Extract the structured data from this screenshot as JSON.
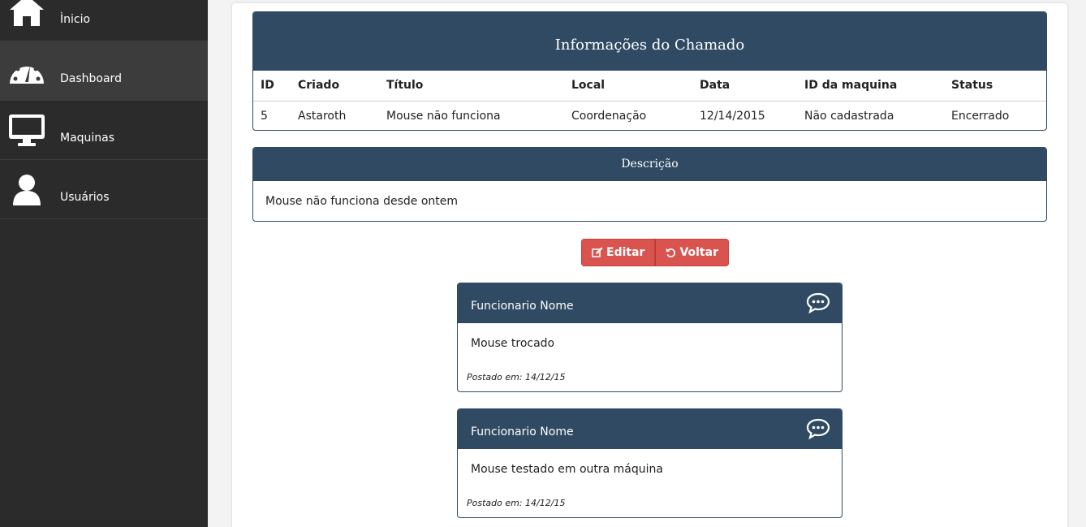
{
  "sidebar": {
    "items": [
      {
        "label": "Ìnicio",
        "icon": "home-icon"
      },
      {
        "label": "Dashboard",
        "icon": "dashboard-icon"
      },
      {
        "label": "Maquinas",
        "icon": "monitor-icon"
      },
      {
        "label": "Usuários",
        "icon": "user-icon"
      }
    ]
  },
  "info": {
    "title": "Informações do Chamado",
    "headers": [
      "ID",
      "Criado",
      "Título",
      "Local",
      "Data",
      "ID da maquina",
      "Status"
    ],
    "row": [
      "5",
      "Astaroth",
      "Mouse não funciona",
      "Coordenação",
      "12/14/2015",
      "Não cadastrada",
      "Encerrado"
    ]
  },
  "description": {
    "title": "Descrição",
    "text": "Mouse não funciona desde ontem"
  },
  "actions": {
    "edit_label": "Editar",
    "back_label": "Voltar"
  },
  "comments": [
    {
      "author": "Funcionario Nome",
      "text": "Mouse trocado",
      "date": "Postado em: 14/12/15"
    },
    {
      "author": "Funcionario Nome",
      "text": "Mouse testado em outra máquina",
      "date": "Postado em: 14/12/15"
    }
  ],
  "colors": {
    "header": "#2f4a62",
    "button": "#d9534f",
    "sidebar": "#2b2b2b"
  }
}
